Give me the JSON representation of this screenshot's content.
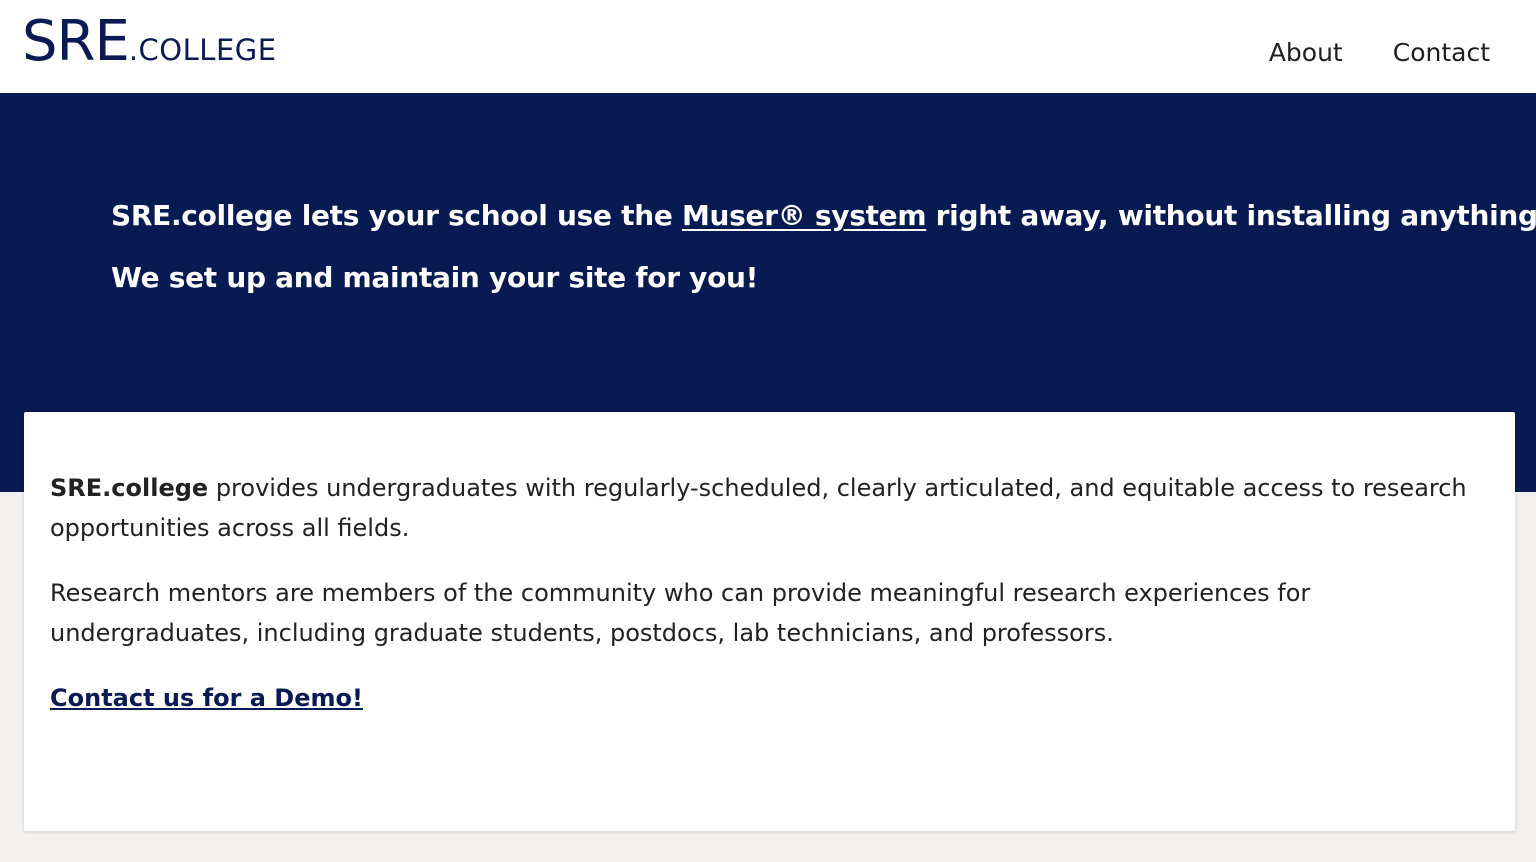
{
  "header": {
    "logo_main": "SRE",
    "logo_suffix": ".COLLEGE",
    "nav": [
      {
        "label": "About"
      },
      {
        "label": "Contact"
      }
    ]
  },
  "hero": {
    "line1_before": "SRE.college lets your school use the ",
    "line1_link": "Muser® system",
    "line1_after": " right away, without installing anything!",
    "line2": "We set up and maintain your site for you!"
  },
  "card": {
    "p1_bold": "SRE.college",
    "p1_rest": " provides undergraduates with regularly-scheduled, clearly articulated, and equitable access to research opportunities across all fields.",
    "p2": "Research mentors are members of the community who can provide meaningful research experiences for undergraduates, including graduate students, postdocs, lab technicians, and professors.",
    "cta": "Contact us for a Demo!"
  },
  "colors": {
    "brand_navy": "#081a52",
    "page_background": "#f2f1ef",
    "card_background": "#ffffff"
  }
}
